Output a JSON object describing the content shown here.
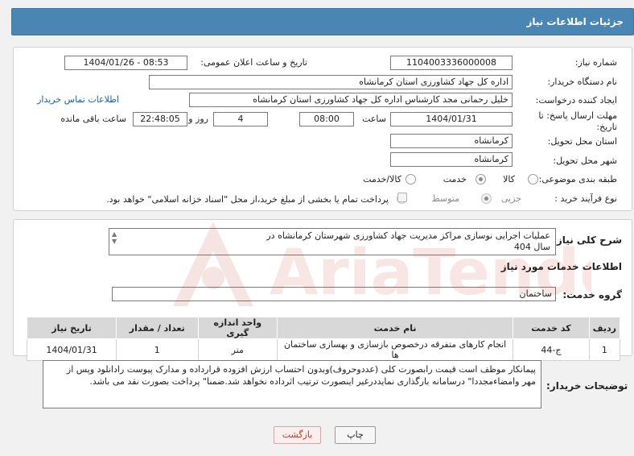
{
  "header": {
    "title": "جزئیات اطلاعات نیاز"
  },
  "form": {
    "need_number_label": "شماره نیاز:",
    "need_number": "1104003336000008",
    "announce_label": "تاریخ و ساعت اعلان عمومی:",
    "announce_value": "1404/01/26 - 08:53",
    "buyer_org_label": "نام دستگاه خریدار:",
    "buyer_org": "اداره کل جهاد کشاورزی استان کرمانشاه",
    "requester_label": "ایجاد کننده درخواست:",
    "requester": "خلیل رحمانی مجد کارشناس اداره کل جهاد کشاورزی استان کرمانشاه",
    "contact_link": "اطلاعات تماس خریدار",
    "deadline_label_1": "مهلت ارسال پاسخ: تا",
    "deadline_label_2": "تاریخ:",
    "deadline_date": "1404/01/31",
    "time_label": "ساعت",
    "deadline_time": "08:00",
    "days_count": "4",
    "days_label": "روز و",
    "remaining_time": "22:48:05",
    "remaining_label": "ساعت باقی مانده",
    "province_label": "استان محل تحویل:",
    "province": "کرمانشاه",
    "city_label": "شهر محل تحویل:",
    "city": "کرمانشاه",
    "category_label": "طبقه بندی موضوعی:",
    "category_options": [
      "کالا",
      "خدمت",
      "کالا/خدمت"
    ],
    "category_selected": "خدمت",
    "process_label": "نوع فرآیند خرید :",
    "process_options": [
      "جزیی",
      "متوسط"
    ],
    "process_selected": "جزیی",
    "payment_note": "پرداخت تمام یا بخشی از مبلغ خرید،از محل \"اسناد خزانه اسلامی\" خواهد بود."
  },
  "description": {
    "label": "شرح کلی نیاز:",
    "text_line1": "عملیات اجرایی نوسازی مراکز مدیریت جهاد کشاورزی شهرستان کرمانشاه در",
    "text_line2": "سال 404"
  },
  "services": {
    "section_title": "اطلاعات خدمات مورد نیاز",
    "group_label": "گروه خدمت:",
    "group_value": "ساختمان",
    "columns": [
      "ردیف",
      "کد خدمت",
      "نام خدمت",
      "واحد اندازه گیری",
      "تعداد / مقدار",
      "تاریخ نیاز"
    ],
    "rows": [
      [
        "1",
        "ج-44",
        "انجام کارهای متفرقه درخصوص بازسازی و بهسازی ساختمان ها",
        "متر",
        "1",
        "1404/01/31"
      ]
    ]
  },
  "buyer_notes": {
    "label": "توضیحات خریدار:",
    "line1": "پیمانکار موظف است قیمت رابصورت کلی (عددوحروف)وبدون احتساب ارزش افزوده قرارداده و مدارک پیوست رادانلود وپس از",
    "line2": "مهر وامضاءمجددا\" درسامانه بارگذاری نمایددرغیر اینصورت ترتیب اثرداده نخواهد شد.ضمنا\" پرداخت بصورت نقد می باشد."
  },
  "buttons": {
    "print": "چاپ",
    "back": "بازگشت"
  },
  "watermark": {
    "text": "AriaTender.net"
  },
  "colors": {
    "header_bg": "#4a86b4",
    "link": "#1a5fa8",
    "back_btn_text": "#c0392b"
  }
}
